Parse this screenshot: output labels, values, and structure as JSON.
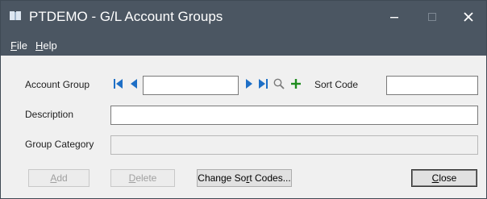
{
  "window": {
    "title": "PTDEMO - G/L Account Groups",
    "titlebar_color": "#4b5662",
    "controls": {
      "minimize_icon": "minimize-icon",
      "maximize_icon": "maximize-icon",
      "close_icon": "close-icon"
    }
  },
  "menu": {
    "file": {
      "accel": "F",
      "rest": "ile"
    },
    "help": {
      "accel": "H",
      "rest": "elp"
    }
  },
  "form": {
    "account_group": {
      "label": "Account Group",
      "value": "",
      "nav_color": "#1e6fc6",
      "new_icon_color": "#1e8c1e"
    },
    "sort_code": {
      "label": "Sort Code",
      "value": ""
    },
    "description": {
      "label": "Description",
      "value": ""
    },
    "group_category": {
      "label": "Group Category",
      "value": ""
    }
  },
  "buttons": {
    "add": {
      "accel": "A",
      "rest": "dd",
      "enabled": false
    },
    "delete": {
      "accel": "D",
      "rest": "elete",
      "enabled": false
    },
    "change_sort_codes": {
      "before": "Change So",
      "accel": "r",
      "after": "t Codes...",
      "enabled": true
    },
    "close": {
      "accel": "C",
      "rest": "lose",
      "enabled": true
    }
  }
}
